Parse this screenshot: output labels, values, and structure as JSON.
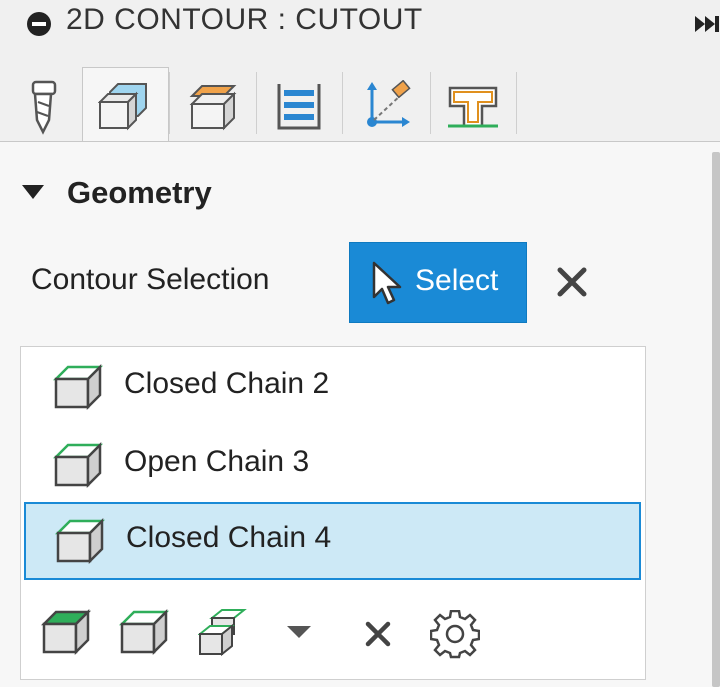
{
  "title": {
    "text": "2D CONTOUR : CUTOUT"
  },
  "tabs": [
    {
      "name": "tool-tab-icon"
    },
    {
      "name": "geometry-tab-icon",
      "active": true
    },
    {
      "name": "heights-tab-icon"
    },
    {
      "name": "passes-tab-icon"
    },
    {
      "name": "linking-tab-icon"
    },
    {
      "name": "contour-profile-tab-icon"
    }
  ],
  "geometry": {
    "section_title": "Geometry",
    "contour_selection_label": "Contour Selection",
    "select_button_label": "Select",
    "chains": [
      {
        "label": "Closed Chain 2",
        "selected": false
      },
      {
        "label": "Open Chain 3",
        "selected": false
      },
      {
        "label": "Closed Chain 4",
        "selected": true
      }
    ]
  },
  "colors": {
    "accent": "#1a8ad6",
    "selected_row": "#cde9f6",
    "chain_green": "#2fae5a"
  }
}
